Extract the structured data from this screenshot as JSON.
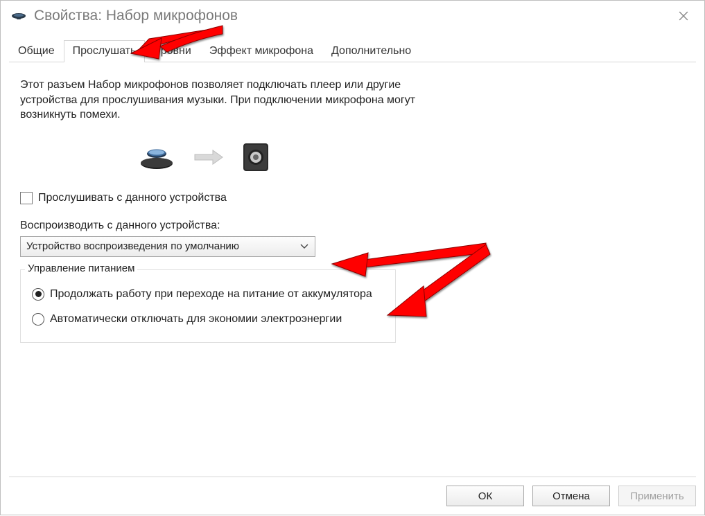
{
  "window": {
    "title": "Свойства: Набор микрофонов"
  },
  "tabs": [
    {
      "label": "Общие"
    },
    {
      "label": "Прослушать"
    },
    {
      "label": "Уровни"
    },
    {
      "label": "Эффект микрофона"
    },
    {
      "label": "Дополнительно"
    }
  ],
  "active_tab_index": 1,
  "content": {
    "description": "Этот разъем Набор микрофонов позволяет подключать плеер или другие устройства для прослушивания музыки. При подключении микрофона могут возникнуть помехи.",
    "listen_checkbox": "Прослушивать с данного устройства",
    "listen_checked": false,
    "playback_label": "Воспроизводить с данного устройства:",
    "playback_selected": "Устройство воспроизведения по умолчанию",
    "power_group": {
      "legend": "Управление питанием",
      "radio_continue": "Продолжать работу при переходе на питание от аккумулятора",
      "radio_autooff": "Автоматически отключать для экономии электроэнергии",
      "selected": "continue"
    }
  },
  "buttons": {
    "ok": "ОК",
    "cancel": "Отмена",
    "apply": "Применить"
  },
  "icons": {
    "mic_device": "microphone-device",
    "arrow_right": "arrow-right",
    "speaker": "speaker-box"
  },
  "colors": {
    "annotation_red": "#ff0000",
    "border": "#bfbfbf"
  }
}
